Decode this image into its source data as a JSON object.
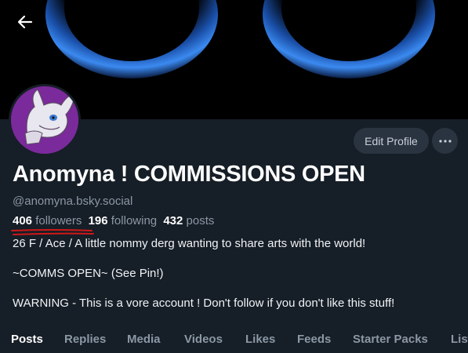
{
  "profile": {
    "display_name": "Anomyna ! COMMISSIONS OPEN",
    "handle": "@anomyna.bsky.social",
    "edit_profile_label": "Edit Profile",
    "more_label": "···"
  },
  "stats": {
    "followers_count": "406",
    "followers_label": "followers",
    "following_count": "196",
    "following_label": "following",
    "posts_count": "432",
    "posts_label": "posts"
  },
  "bio": {
    "line1": "26 F / Ace / A little nommy derg wanting to share arts with the world!",
    "line2": "~COMMS OPEN~ (See Pin!)",
    "line3": "WARNING - This is a vore account ! Don't follow if you don't like this stuff!"
  },
  "tabs": [
    {
      "label": "Posts",
      "active": true
    },
    {
      "label": "Replies"
    },
    {
      "label": "Media"
    },
    {
      "label": "Videos"
    },
    {
      "label": "Likes"
    },
    {
      "label": "Feeds"
    },
    {
      "label": "Starter Packs"
    },
    {
      "label": "Lists"
    }
  ],
  "icons": {
    "back": "arrow-left-icon",
    "more": "ellipsis-icon"
  },
  "colors": {
    "background": "#161e27",
    "button_bg": "#2a3441",
    "muted_text": "#8b98a5",
    "avatar_bg": "#7b2a9b",
    "eye_blue": "#2a6fd6",
    "annotation_red": "#d01818"
  }
}
